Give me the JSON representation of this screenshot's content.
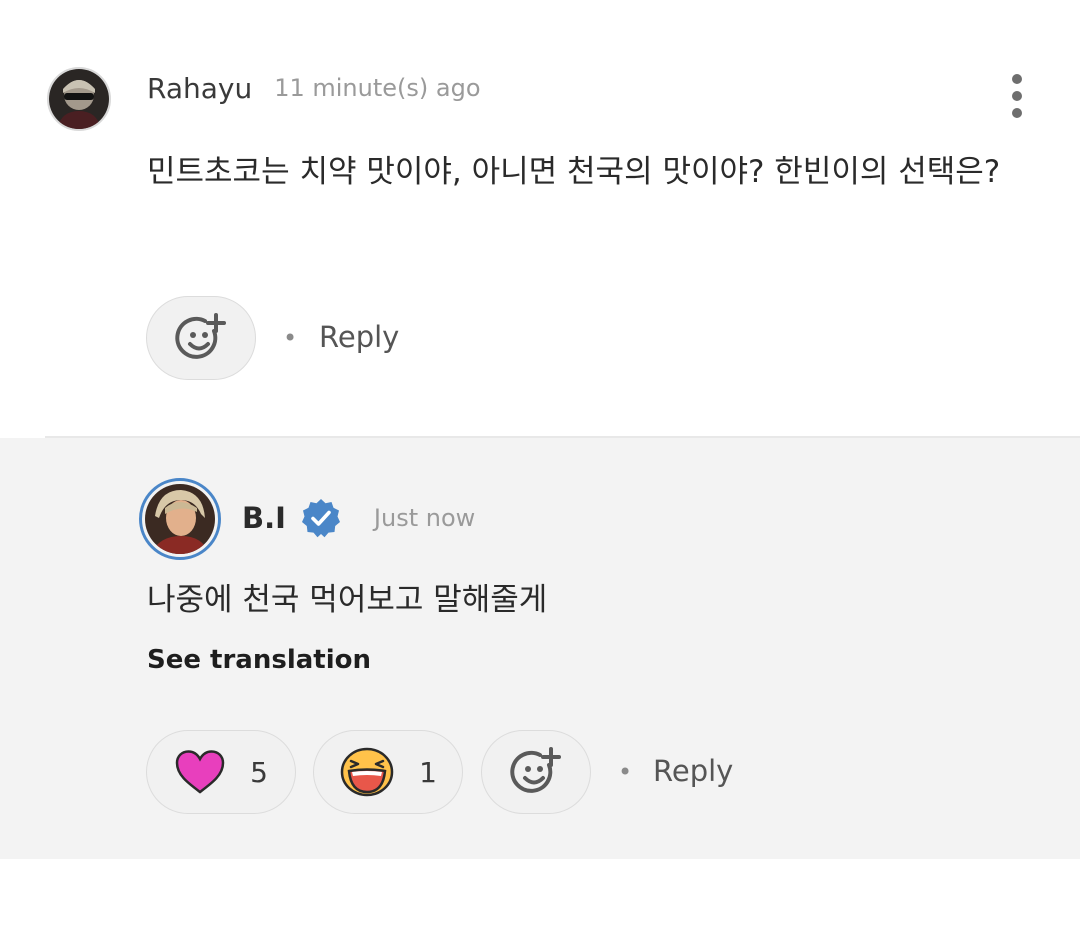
{
  "comment": {
    "username": "Rahayu",
    "timestamp": "11 minute(s) ago",
    "body": "민트초코는 치약 맛이야, 아니면 천국의 맛이야? 한빈이의 선택은?",
    "add_reaction_icon": "add-emoji-icon",
    "separator": "•",
    "reply_label": "Reply",
    "more_icon": "more-vertical-icon"
  },
  "reply": {
    "username": "B.I",
    "verified_icon": "verified-badge-icon",
    "timestamp": "Just now",
    "body": "나중에 천국 먹어보고 말해줄게",
    "see_translation": "See translation",
    "reactions": [
      {
        "icon": "heart-icon",
        "count": "5",
        "color": "#e83fbd"
      },
      {
        "icon": "laughing-face-icon",
        "count": "1",
        "color": "#ff9a3c"
      }
    ],
    "add_reaction_icon": "add-emoji-icon",
    "separator": "•",
    "reply_label": "Reply"
  },
  "colors": {
    "reply_background": "#f3f3f3",
    "verified_blue": "#4a86c8",
    "heart_pink": "#e83fbd"
  }
}
